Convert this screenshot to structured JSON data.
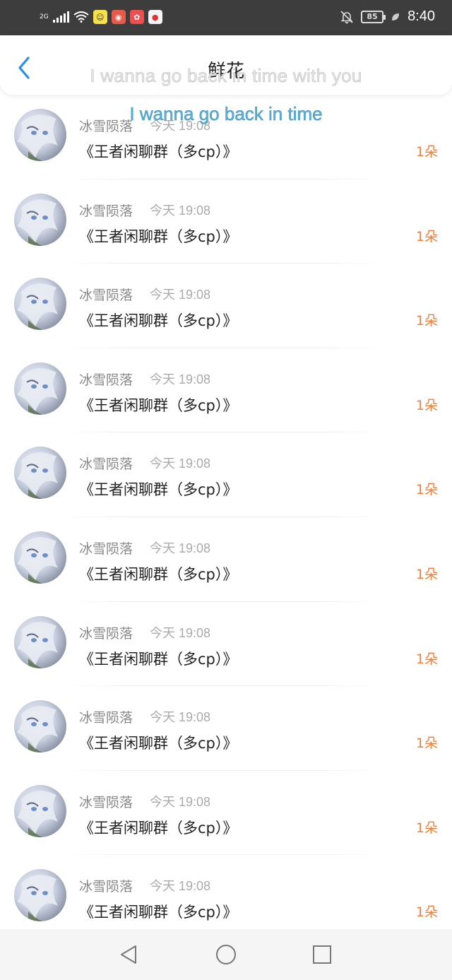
{
  "status_bar": {
    "signal_label": "2G",
    "battery": "85",
    "time": "8:40",
    "icons": [
      "signal-icon",
      "wifi-icon",
      "app-icon-1",
      "app-icon-2",
      "app-icon-3",
      "app-icon-4",
      "mute-bell-icon",
      "battery-icon",
      "leaf-icon"
    ]
  },
  "nav": {
    "title": "鲜花",
    "back_icon": "chevron-left-icon"
  },
  "overlay": {
    "line1": "I wanna go back in time with you",
    "line2": "I wanna go back in time"
  },
  "items": [
    {
      "name": "冰雪陨落",
      "time": "今天 19:08",
      "message": "《王者闲聊群（多cp）》",
      "flowers": "1朵"
    },
    {
      "name": "冰雪陨落",
      "time": "今天 19:08",
      "message": "《王者闲聊群（多cp）》",
      "flowers": "1朵"
    },
    {
      "name": "冰雪陨落",
      "time": "今天 19:08",
      "message": "《王者闲聊群（多cp）》",
      "flowers": "1朵"
    },
    {
      "name": "冰雪陨落",
      "time": "今天 19:08",
      "message": "《王者闲聊群（多cp）》",
      "flowers": "1朵"
    },
    {
      "name": "冰雪陨落",
      "time": "今天 19:08",
      "message": "《王者闲聊群（多cp）》",
      "flowers": "1朵"
    },
    {
      "name": "冰雪陨落",
      "time": "今天 19:08",
      "message": "《王者闲聊群（多cp）》",
      "flowers": "1朵"
    },
    {
      "name": "冰雪陨落",
      "time": "今天 19:08",
      "message": "《王者闲聊群（多cp）》",
      "flowers": "1朵"
    },
    {
      "name": "冰雪陨落",
      "time": "今天 19:08",
      "message": "《王者闲聊群（多cp）》",
      "flowers": "1朵"
    },
    {
      "name": "冰雪陨落",
      "time": "今天 19:08",
      "message": "《王者闲聊群（多cp）》",
      "flowers": "1朵"
    },
    {
      "name": "冰雪陨落",
      "time": "今天 19:08",
      "message": "《王者闲聊群（多cp）》",
      "flowers": "1朵"
    }
  ],
  "bottom_nav": [
    "back-triangle-icon",
    "home-circle-icon",
    "recents-square-icon"
  ],
  "colors": {
    "accent": "#2a8fe0",
    "flower": "#f07f3a",
    "status_bar": "#3d3d3d"
  }
}
